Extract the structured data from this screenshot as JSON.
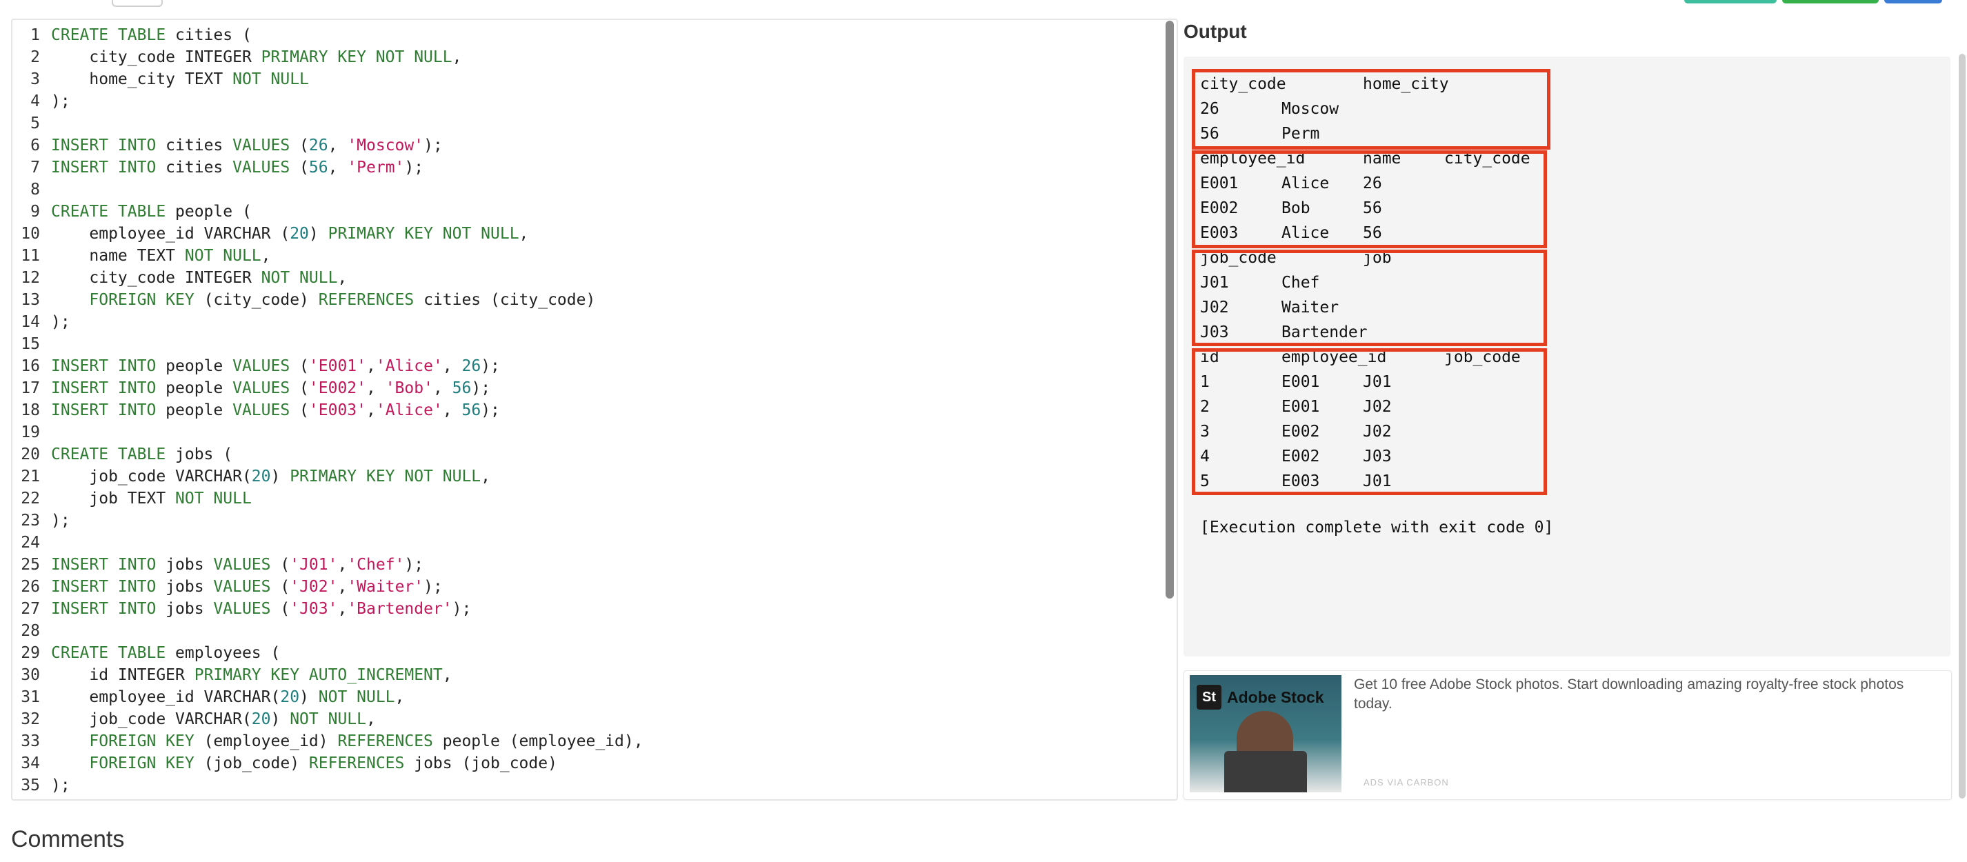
{
  "toolbar": {
    "button_colors": [
      "#3dbf9e",
      "#35b04a",
      "#3a7bd5"
    ]
  },
  "editor": {
    "lines": [
      [
        {
          "t": "CREATE TABLE",
          "k": "kw"
        },
        {
          "t": " cities ("
        }
      ],
      [
        {
          "t": "    city_code INTEGER "
        },
        {
          "t": "PRIMARY KEY NOT NULL",
          "k": "kw"
        },
        {
          "t": ","
        }
      ],
      [
        {
          "t": "    home_city TEXT "
        },
        {
          "t": "NOT NULL",
          "k": "kw"
        }
      ],
      [
        {
          "t": ");"
        }
      ],
      [],
      [
        {
          "t": "INSERT INTO",
          "k": "kw"
        },
        {
          "t": " cities "
        },
        {
          "t": "VALUES",
          "k": "kw"
        },
        {
          "t": " ("
        },
        {
          "t": "26",
          "k": "num"
        },
        {
          "t": ", "
        },
        {
          "t": "'Moscow'",
          "k": "str"
        },
        {
          "t": ");"
        }
      ],
      [
        {
          "t": "INSERT INTO",
          "k": "kw"
        },
        {
          "t": " cities "
        },
        {
          "t": "VALUES",
          "k": "kw"
        },
        {
          "t": " ("
        },
        {
          "t": "56",
          "k": "num"
        },
        {
          "t": ", "
        },
        {
          "t": "'Perm'",
          "k": "str"
        },
        {
          "t": ");"
        }
      ],
      [],
      [
        {
          "t": "CREATE TABLE",
          "k": "kw"
        },
        {
          "t": " people ("
        }
      ],
      [
        {
          "t": "    employee_id VARCHAR ("
        },
        {
          "t": "20",
          "k": "num"
        },
        {
          "t": ") "
        },
        {
          "t": "PRIMARY KEY NOT NULL",
          "k": "kw"
        },
        {
          "t": ","
        }
      ],
      [
        {
          "t": "    name TEXT "
        },
        {
          "t": "NOT NULL",
          "k": "kw"
        },
        {
          "t": ","
        }
      ],
      [
        {
          "t": "    city_code INTEGER "
        },
        {
          "t": "NOT NULL",
          "k": "kw"
        },
        {
          "t": ","
        }
      ],
      [
        {
          "t": "    "
        },
        {
          "t": "FOREIGN KEY",
          "k": "kw"
        },
        {
          "t": " (city_code) "
        },
        {
          "t": "REFERENCES",
          "k": "kw"
        },
        {
          "t": " cities (city_code)"
        }
      ],
      [
        {
          "t": ");"
        }
      ],
      [],
      [
        {
          "t": "INSERT INTO",
          "k": "kw"
        },
        {
          "t": " people "
        },
        {
          "t": "VALUES",
          "k": "kw"
        },
        {
          "t": " ("
        },
        {
          "t": "'E001'",
          "k": "str"
        },
        {
          "t": ","
        },
        {
          "t": "'Alice'",
          "k": "str"
        },
        {
          "t": ", "
        },
        {
          "t": "26",
          "k": "num"
        },
        {
          "t": ");"
        }
      ],
      [
        {
          "t": "INSERT INTO",
          "k": "kw"
        },
        {
          "t": " people "
        },
        {
          "t": "VALUES",
          "k": "kw"
        },
        {
          "t": " ("
        },
        {
          "t": "'E002'",
          "k": "str"
        },
        {
          "t": ", "
        },
        {
          "t": "'Bob'",
          "k": "str"
        },
        {
          "t": ", "
        },
        {
          "t": "56",
          "k": "num"
        },
        {
          "t": ");"
        }
      ],
      [
        {
          "t": "INSERT INTO",
          "k": "kw"
        },
        {
          "t": " people "
        },
        {
          "t": "VALUES",
          "k": "kw"
        },
        {
          "t": " ("
        },
        {
          "t": "'E003'",
          "k": "str"
        },
        {
          "t": ","
        },
        {
          "t": "'Alice'",
          "k": "str"
        },
        {
          "t": ", "
        },
        {
          "t": "56",
          "k": "num"
        },
        {
          "t": ");"
        }
      ],
      [],
      [
        {
          "t": "CREATE TABLE",
          "k": "kw"
        },
        {
          "t": " jobs ("
        }
      ],
      [
        {
          "t": "    job_code VARCHAR("
        },
        {
          "t": "20",
          "k": "num"
        },
        {
          "t": ") "
        },
        {
          "t": "PRIMARY KEY NOT NULL",
          "k": "kw"
        },
        {
          "t": ","
        }
      ],
      [
        {
          "t": "    job TEXT "
        },
        {
          "t": "NOT NULL",
          "k": "kw"
        }
      ],
      [
        {
          "t": ");"
        }
      ],
      [],
      [
        {
          "t": "INSERT INTO",
          "k": "kw"
        },
        {
          "t": " jobs "
        },
        {
          "t": "VALUES",
          "k": "kw"
        },
        {
          "t": " ("
        },
        {
          "t": "'J01'",
          "k": "str"
        },
        {
          "t": ","
        },
        {
          "t": "'Chef'",
          "k": "str"
        },
        {
          "t": ");"
        }
      ],
      [
        {
          "t": "INSERT INTO",
          "k": "kw"
        },
        {
          "t": " jobs "
        },
        {
          "t": "VALUES",
          "k": "kw"
        },
        {
          "t": " ("
        },
        {
          "t": "'J02'",
          "k": "str"
        },
        {
          "t": ","
        },
        {
          "t": "'Waiter'",
          "k": "str"
        },
        {
          "t": ");"
        }
      ],
      [
        {
          "t": "INSERT INTO",
          "k": "kw"
        },
        {
          "t": " jobs "
        },
        {
          "t": "VALUES",
          "k": "kw"
        },
        {
          "t": " ("
        },
        {
          "t": "'J03'",
          "k": "str"
        },
        {
          "t": ","
        },
        {
          "t": "'Bartender'",
          "k": "str"
        },
        {
          "t": ");"
        }
      ],
      [],
      [
        {
          "t": "CREATE TABLE",
          "k": "kw"
        },
        {
          "t": " employees ("
        }
      ],
      [
        {
          "t": "    id INTEGER "
        },
        {
          "t": "PRIMARY KEY AUTO_INCREMENT",
          "k": "kw"
        },
        {
          "t": ","
        }
      ],
      [
        {
          "t": "    employee_id VARCHAR("
        },
        {
          "t": "20",
          "k": "num"
        },
        {
          "t": ") "
        },
        {
          "t": "NOT NULL",
          "k": "kw"
        },
        {
          "t": ","
        }
      ],
      [
        {
          "t": "    job_code VARCHAR("
        },
        {
          "t": "20",
          "k": "num"
        },
        {
          "t": ") "
        },
        {
          "t": "NOT NULL",
          "k": "kw"
        },
        {
          "t": ","
        }
      ],
      [
        {
          "t": "    "
        },
        {
          "t": "FOREIGN KEY",
          "k": "kw"
        },
        {
          "t": " (employee_id) "
        },
        {
          "t": "REFERENCES",
          "k": "kw"
        },
        {
          "t": " people (employee_id),"
        }
      ],
      [
        {
          "t": "    "
        },
        {
          "t": "FOREIGN KEY",
          "k": "kw"
        },
        {
          "t": " (job_code) "
        },
        {
          "t": "REFERENCES",
          "k": "kw"
        },
        {
          "t": " jobs (job_code)"
        }
      ],
      [
        {
          "t": ");"
        }
      ]
    ]
  },
  "output": {
    "title": "Output",
    "tables": [
      {
        "rows": [
          [
            "city_code",
            "home_city"
          ],
          [
            "26",
            "Moscow"
          ],
          [
            "56",
            "Perm"
          ]
        ],
        "cols": [
          [
            "c1",
            "c3"
          ],
          [
            "c1",
            "c2"
          ],
          [
            "c1",
            "c2"
          ]
        ]
      },
      {
        "rows": [
          [
            "employee_id",
            "name",
            "city_code"
          ],
          [
            "E001",
            "Alice",
            "26"
          ],
          [
            "E002",
            "Bob",
            "56"
          ],
          [
            "E003",
            "Alice",
            "56"
          ]
        ],
        "cols": [
          [
            "c1",
            "c3",
            "c4"
          ],
          [
            "c1",
            "c2",
            "c3"
          ],
          [
            "c1",
            "c2",
            "c3"
          ],
          [
            "c1",
            "c2",
            "c3"
          ]
        ]
      },
      {
        "rows": [
          [
            "job_code",
            "job"
          ],
          [
            "J01",
            "Chef"
          ],
          [
            "J02",
            "Waiter"
          ],
          [
            "J03",
            "Bartender"
          ]
        ],
        "cols": [
          [
            "c1",
            "c3"
          ],
          [
            "c1",
            "c2"
          ],
          [
            "c1",
            "c2"
          ],
          [
            "c1",
            "c2"
          ]
        ]
      },
      {
        "rows": [
          [
            "id",
            "employee_id",
            "job_code"
          ],
          [
            "1",
            "E001",
            "J01"
          ],
          [
            "2",
            "E001",
            "J02"
          ],
          [
            "3",
            "E002",
            "J02"
          ],
          [
            "4",
            "E002",
            "J03"
          ],
          [
            "5",
            "E003",
            "J01"
          ]
        ],
        "cols": [
          [
            "c1",
            "c2",
            "c4"
          ],
          [
            "c1",
            "c2",
            "c3"
          ],
          [
            "c1",
            "c2",
            "c3"
          ],
          [
            "c1",
            "c2",
            "c3"
          ],
          [
            "c1",
            "c2",
            "c3"
          ],
          [
            "c1",
            "c2",
            "c3"
          ]
        ]
      }
    ],
    "exec_message": "[Execution complete with exit code 0]",
    "highlight_color": "#e53d1f"
  },
  "ad": {
    "brand": "Adobe Stock",
    "logo_mark": "St",
    "text": "Get 10 free Adobe Stock photos. Start downloading amazing royalty-free stock photos today.",
    "via": "ADS VIA CARBON"
  },
  "comments": {
    "heading": "Comments"
  }
}
